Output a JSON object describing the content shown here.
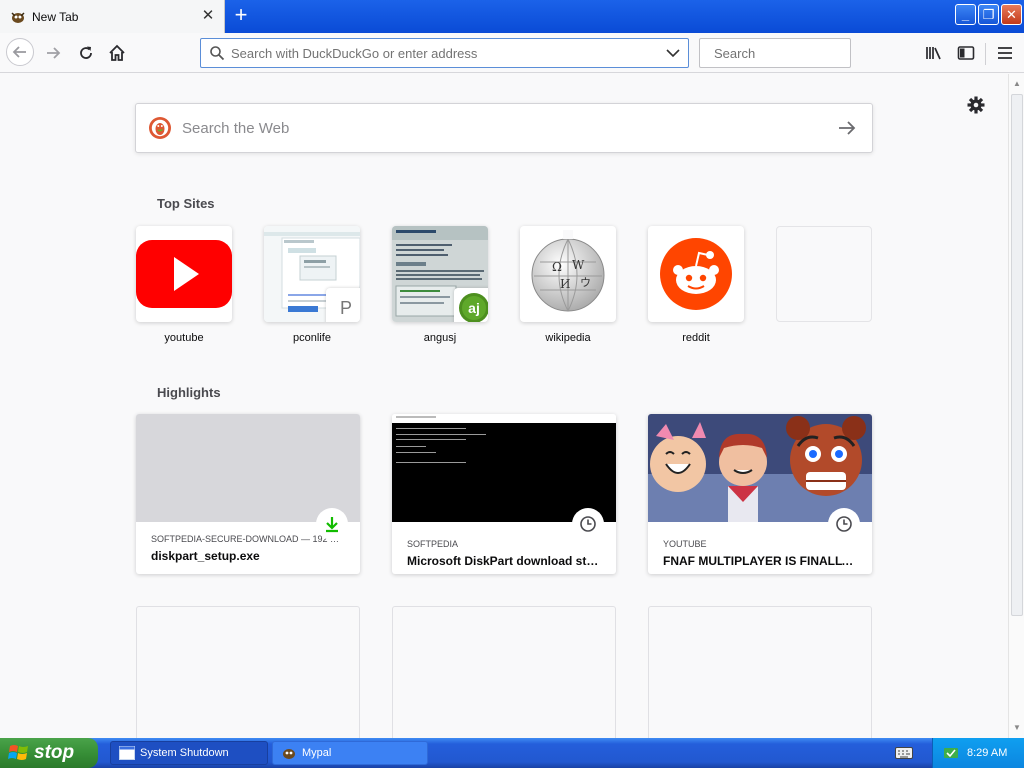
{
  "browser": {
    "tab": {
      "title": "New Tab"
    },
    "urlbar": {
      "placeholder": "Search with DuckDuckGo or enter address"
    },
    "searchbar": {
      "placeholder": "Search"
    }
  },
  "newtab": {
    "websearch": {
      "placeholder": "Search the Web"
    },
    "top_sites_title": "Top Sites",
    "top_sites": [
      {
        "label": "youtube"
      },
      {
        "label": "pconlife",
        "badge": "P"
      },
      {
        "label": "angusj",
        "badge": "aj"
      },
      {
        "label": "wikipedia"
      },
      {
        "label": "reddit"
      }
    ],
    "highlights_title": "Highlights",
    "highlights": [
      {
        "context": "SOFTPEDIA-SECURE-DOWNLOAD — 192 …",
        "title": "diskpart_setup.exe",
        "badge_icon": "download-icon"
      },
      {
        "context": "SOFTPEDIA",
        "title": "Microsoft DiskPart download sta…",
        "badge_icon": "clock-icon"
      },
      {
        "context": "YOUTUBE",
        "title": "FNAF MULTIPLAYER IS FINALLY …",
        "badge_icon": "clock-icon"
      }
    ]
  },
  "taskbar": {
    "start_label": "stop",
    "items": [
      {
        "label": "System Shutdown"
      },
      {
        "label": "Mypal"
      }
    ],
    "clock": "8:29 AM"
  },
  "colors": {
    "youtube_red": "#ff0000",
    "reddit_orange": "#ff4500",
    "xp_blue": "#245edb",
    "xp_green": "#378f37"
  }
}
